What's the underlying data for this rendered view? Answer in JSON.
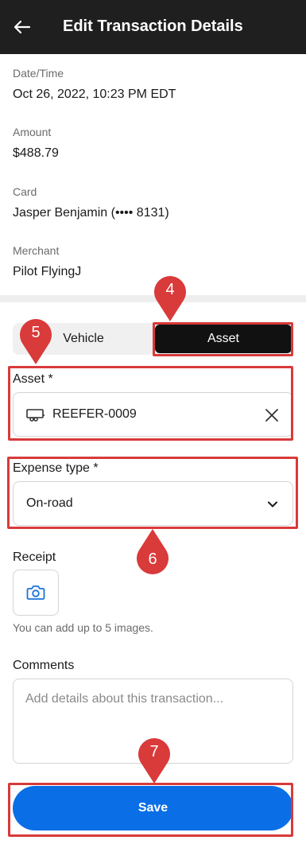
{
  "header": {
    "title": "Edit Transaction Details",
    "back_icon": "arrow-left-icon"
  },
  "details": [
    {
      "label": "Date/Time",
      "value": "Oct 26, 2022, 10:23 PM EDT"
    },
    {
      "label": "Amount",
      "value": "$488.79"
    },
    {
      "label": "Card",
      "value": "Jasper Benjamin (•••• 8131)"
    },
    {
      "label": "Merchant",
      "value": "Pilot FlyingJ"
    }
  ],
  "segmented": {
    "options": [
      "Vehicle",
      "Asset"
    ],
    "selected": "Asset"
  },
  "asset_field": {
    "label": "Asset *",
    "value": "REEFER-0009",
    "icon": "trailer-icon",
    "clear_icon": "close-icon"
  },
  "expense_field": {
    "label": "Expense type *",
    "value": "On-road",
    "icon": "chevron-down-icon"
  },
  "receipt": {
    "label": "Receipt",
    "icon": "camera-icon",
    "helper": "You can add up to 5 images."
  },
  "comments": {
    "label": "Comments",
    "placeholder": "Add details about this transaction..."
  },
  "save_label": "Save",
  "annotations": [
    "4",
    "5",
    "6",
    "7"
  ],
  "colors": {
    "header_bg": "#1f1f1f",
    "primary": "#0a6ee6",
    "annotation": "#d93a3a",
    "icon_blue": "#1a73d9"
  }
}
